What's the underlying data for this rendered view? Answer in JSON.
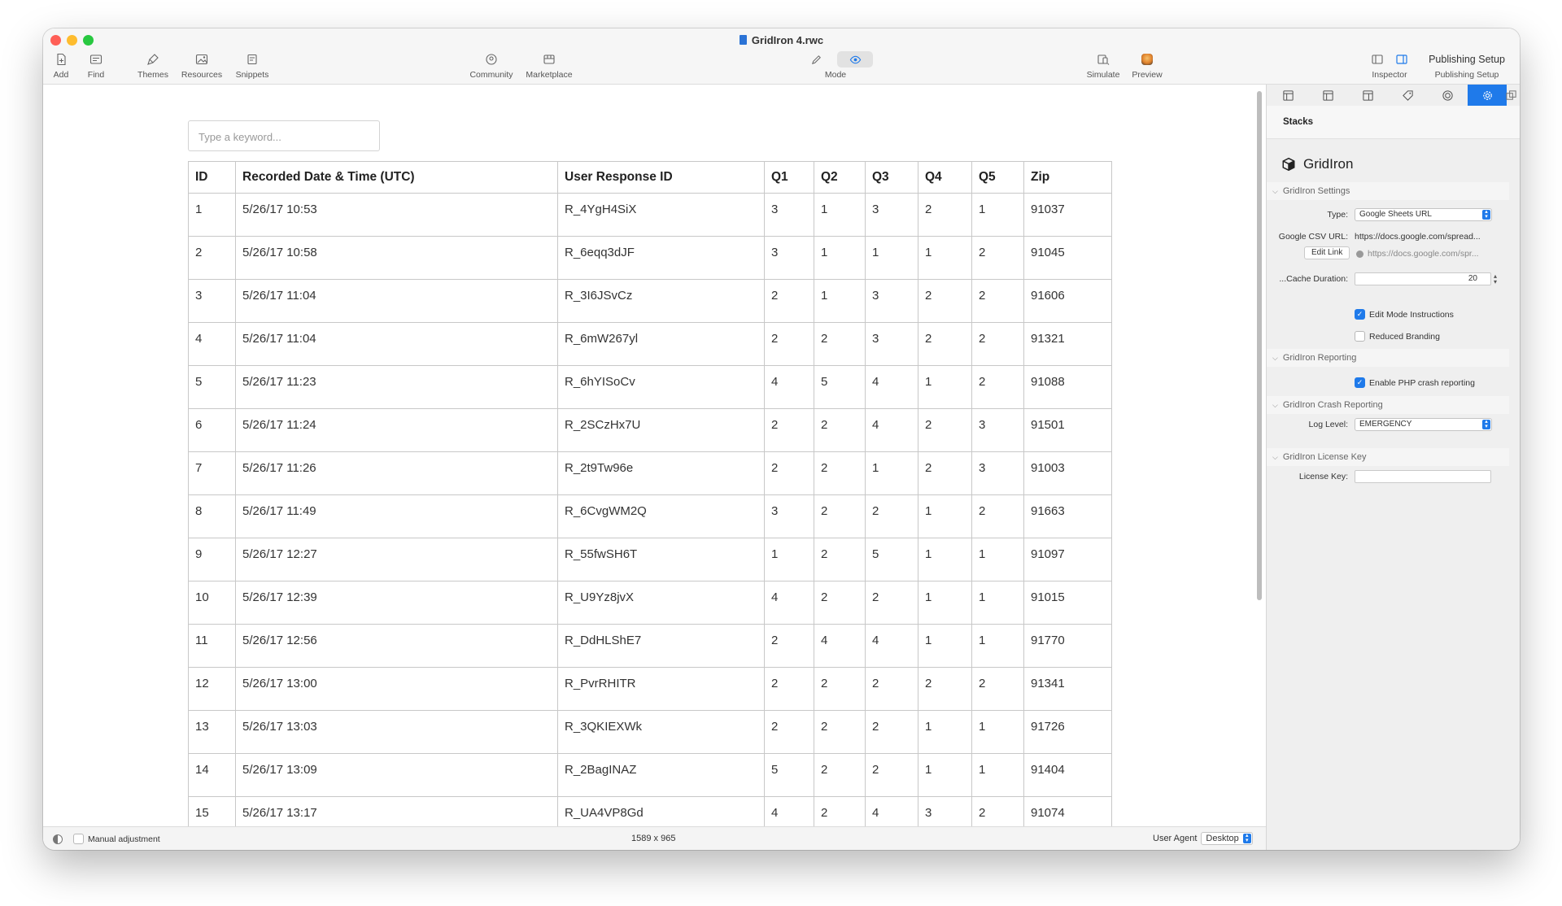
{
  "window": {
    "title": "GridIron 4.rwc"
  },
  "toolbar": {
    "add": "Add",
    "find": "Find",
    "themes": "Themes",
    "resources": "Resources",
    "snippets": "Snippets",
    "community": "Community",
    "marketplace": "Marketplace",
    "mode": "Mode",
    "simulate": "Simulate",
    "preview": "Preview",
    "inspector": "Inspector",
    "publishing_setup_button": "Publishing Setup",
    "publishing_setup": "Publishing Setup"
  },
  "search": {
    "placeholder": "Type a keyword..."
  },
  "table": {
    "headers": [
      "ID",
      "Recorded Date & Time (UTC)",
      "User Response ID",
      "Q1",
      "Q2",
      "Q3",
      "Q4",
      "Q5",
      "Zip"
    ],
    "rows": [
      [
        "1",
        "5/26/17 10:53",
        "R_4YgH4SiX",
        "3",
        "1",
        "3",
        "2",
        "1",
        "91037"
      ],
      [
        "2",
        "5/26/17 10:58",
        "R_6eqq3dJF",
        "3",
        "1",
        "1",
        "1",
        "2",
        "91045"
      ],
      [
        "3",
        "5/26/17 11:04",
        "R_3I6JSvCz",
        "2",
        "1",
        "3",
        "2",
        "2",
        "91606"
      ],
      [
        "4",
        "5/26/17 11:04",
        "R_6mW267yl",
        "2",
        "2",
        "3",
        "2",
        "2",
        "91321"
      ],
      [
        "5",
        "5/26/17 11:23",
        "R_6hYISoCv",
        "4",
        "5",
        "4",
        "1",
        "2",
        "91088"
      ],
      [
        "6",
        "5/26/17 11:24",
        "R_2SCzHx7U",
        "2",
        "2",
        "4",
        "2",
        "3",
        "91501"
      ],
      [
        "7",
        "5/26/17 11:26",
        "R_2t9Tw96e",
        "2",
        "2",
        "1",
        "2",
        "3",
        "91003"
      ],
      [
        "8",
        "5/26/17 11:49",
        "R_6CvgWM2Q",
        "3",
        "2",
        "2",
        "1",
        "2",
        "91663"
      ],
      [
        "9",
        "5/26/17 12:27",
        "R_55fwSH6T",
        "1",
        "2",
        "5",
        "1",
        "1",
        "91097"
      ],
      [
        "10",
        "5/26/17 12:39",
        "R_U9Yz8jvX",
        "4",
        "2",
        "2",
        "1",
        "1",
        "91015"
      ],
      [
        "11",
        "5/26/17 12:56",
        "R_DdHLShE7",
        "2",
        "4",
        "4",
        "1",
        "1",
        "91770"
      ],
      [
        "12",
        "5/26/17 13:00",
        "R_PvrRHITR",
        "2",
        "2",
        "2",
        "2",
        "2",
        "91341"
      ],
      [
        "13",
        "5/26/17 13:03",
        "R_3QKIEXWk",
        "2",
        "2",
        "2",
        "1",
        "1",
        "91726"
      ],
      [
        "14",
        "5/26/17 13:09",
        "R_2BagINAZ",
        "5",
        "2",
        "2",
        "1",
        "1",
        "91404"
      ],
      [
        "15",
        "5/26/17 13:17",
        "R_UA4VP8Gd",
        "4",
        "2",
        "4",
        "3",
        "2",
        "91074"
      ]
    ]
  },
  "inspector": {
    "stacks_label": "Stacks",
    "stack_name": "GridIron",
    "settings": {
      "heading": "GridIron Settings",
      "type_label": "Type:",
      "type_value": "Google Sheets URL",
      "csv_label": "Google CSV URL:",
      "csv_value": "https://docs.google.com/spread...",
      "edit_link": "Edit Link",
      "link_preview": "https://docs.google.com/spr...",
      "cache_label": "...Cache Duration:",
      "cache_value": "20",
      "edit_mode_instructions": "Edit Mode Instructions",
      "edit_mode_checked": true,
      "reduced_branding": "Reduced Branding",
      "reduced_branding_checked": false
    },
    "reporting": {
      "heading": "GridIron Reporting",
      "php_crash": "Enable PHP crash reporting",
      "php_crash_checked": true
    },
    "crash": {
      "heading": "GridIron Crash Reporting",
      "log_level_label": "Log Level:",
      "log_level_value": "EMERGENCY"
    },
    "license": {
      "heading": "GridIron License Key",
      "license_label": "License Key:",
      "license_value": ""
    }
  },
  "statusbar": {
    "manual_adjustment": "Manual adjustment",
    "dimensions": "1589 x 965",
    "user_agent_label": "User Agent",
    "user_agent_value": "Desktop"
  },
  "colors": {
    "accent": "#1f7aea",
    "close": "#ff5f57",
    "minimize": "#febc2e",
    "zoom": "#28c840"
  }
}
